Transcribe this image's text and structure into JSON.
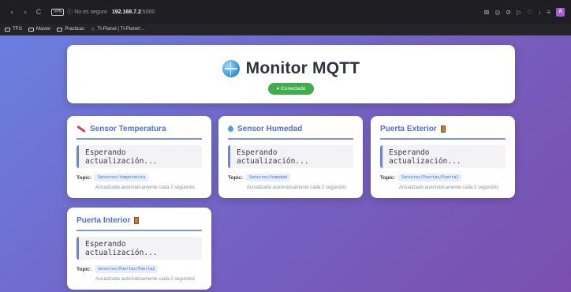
{
  "browser": {
    "nav": {
      "back": "‹",
      "forward": "›",
      "reload": "C"
    },
    "vpn": "VPN",
    "insecure": "ⓘ No es seguro",
    "host": "192.168.7.2",
    "port": ":5000",
    "profile": "A",
    "right_icons": [
      "⊠",
      "◎",
      "⊘",
      "▷",
      "♡",
      "↓",
      "≡"
    ]
  },
  "bookmarks": [
    {
      "label": "TFG",
      "type": "folder"
    },
    {
      "label": "Master",
      "type": "folder"
    },
    {
      "label": "Practicas",
      "type": "folder"
    },
    {
      "label": "TI-Planet | TI-Planet'...",
      "type": "site"
    }
  ],
  "header": {
    "title": "Monitor MQTT",
    "status": "● Conectado"
  },
  "cards": [
    {
      "title": "Sensor Temperatura",
      "icon": "thermometer-icon",
      "value": "Esperando actualización...",
      "topic_label": "Topic:",
      "topic": "Sensores/temperatura",
      "note": "Actualizado automáticamente cada 2 segundos"
    },
    {
      "title": "Sensor Humedad",
      "icon": "droplet-icon",
      "value": "Esperando actualización...",
      "topic_label": "Topic:",
      "topic": "Sensores/humedad",
      "note": "Actualizado automáticamente cada 2 segundos"
    },
    {
      "title": "Puerta Exterior",
      "icon": "door-icon",
      "value": "Esperando actualización...",
      "topic_label": "Topic:",
      "topic": "Sensores/Puertas/Puerta1",
      "note": "Actualizado automáticamente cada 2 segundos"
    },
    {
      "title": "Puerta Interior",
      "icon": "door-icon",
      "value": "Esperando actualización...",
      "topic_label": "Topic:",
      "topic": "Sensores/Puertas/Puerta2",
      "note": "Actualizado automáticamente cada 2 segundos"
    }
  ]
}
